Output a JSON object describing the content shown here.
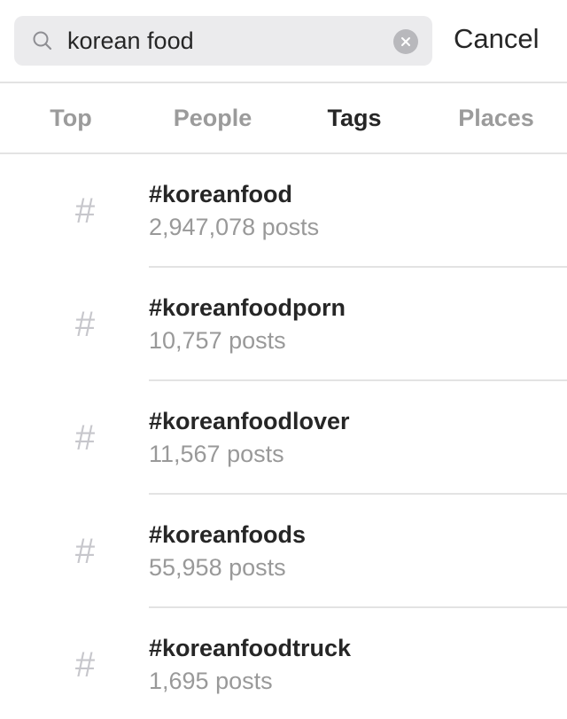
{
  "search": {
    "value": "korean food",
    "placeholder": "Search",
    "cancel_label": "Cancel"
  },
  "tabs": [
    {
      "label": "Top",
      "active": false
    },
    {
      "label": "People",
      "active": false
    },
    {
      "label": "Tags",
      "active": true
    },
    {
      "label": "Places",
      "active": false
    }
  ],
  "results": [
    {
      "icon": "hashtag-icon",
      "symbol": "#",
      "name": "#koreanfood",
      "count": "2,947,078 posts"
    },
    {
      "icon": "hashtag-icon",
      "symbol": "#",
      "name": "#koreanfoodporn",
      "count": "10,757 posts"
    },
    {
      "icon": "hashtag-icon",
      "symbol": "#",
      "name": "#koreanfoodlover",
      "count": "11,567 posts"
    },
    {
      "icon": "hashtag-icon",
      "symbol": "#",
      "name": "#koreanfoods",
      "count": "55,958 posts"
    },
    {
      "icon": "hashtag-icon",
      "symbol": "#",
      "name": "#koreanfoodtruck",
      "count": "1,695 posts"
    }
  ],
  "colors": {
    "text_primary": "#262626",
    "text_secondary": "#999999",
    "search_bg": "#ebebed"
  }
}
